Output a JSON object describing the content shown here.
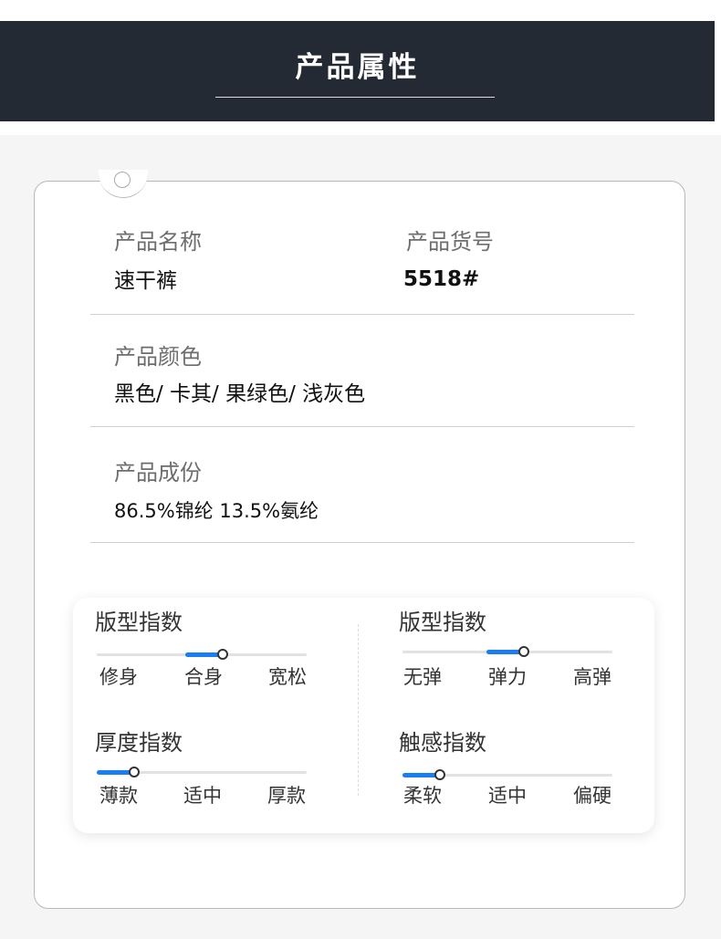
{
  "header": {
    "title": "产品属性"
  },
  "info": {
    "name_label": "产品名称",
    "name_value": "速干裤",
    "sku_label": "产品货号",
    "sku_value": "5518#",
    "color_label": "产品颜色",
    "color_value": "黑色/ 卡其/ 果绿色/ 浅灰色",
    "material_label": "产品成份",
    "material_value": "86.5%锦纶 13.5%氨纶"
  },
  "indices": [
    {
      "title": "版型指数",
      "options": [
        "修身",
        "合身",
        "宽松"
      ],
      "fill_start": 0.42,
      "level": 0.6,
      "accent": "#1a7ef2"
    },
    {
      "title": "版型指数",
      "options": [
        "无弹",
        "弹力",
        "高弹"
      ],
      "fill_start": 0.4,
      "level": 0.58,
      "accent": "#1a7ef2"
    },
    {
      "title": "厚度指数",
      "options": [
        "薄款",
        "适中",
        "厚款"
      ],
      "fill_start": 0.0,
      "level": 0.18,
      "accent": "#1a7ef2"
    },
    {
      "title": "触感指数",
      "options": [
        "柔软",
        "适中",
        "偏硬"
      ],
      "fill_start": 0.0,
      "level": 0.18,
      "accent": "#1a7ef2"
    }
  ]
}
